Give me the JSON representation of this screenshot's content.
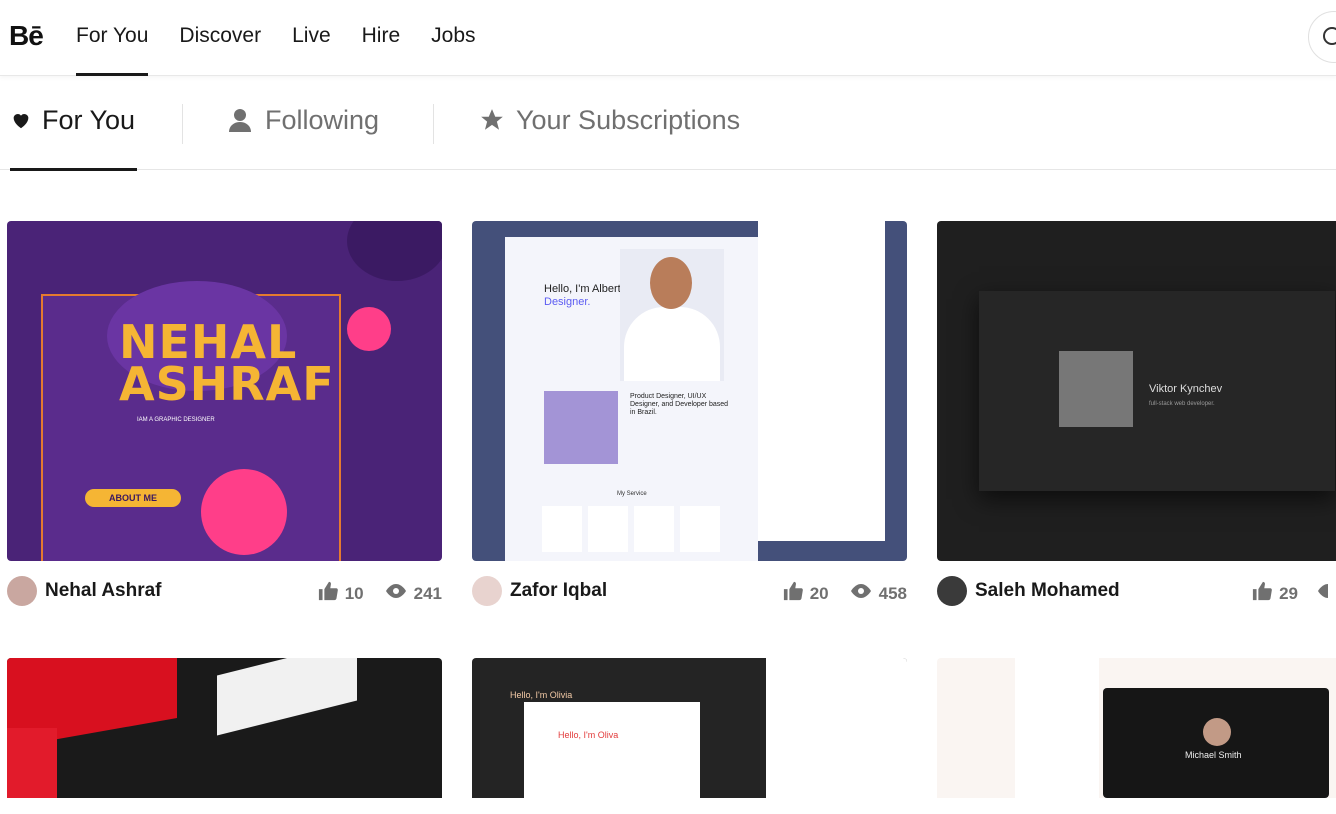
{
  "header": {
    "logo": "Bē",
    "nav": [
      "For You",
      "Discover",
      "Live",
      "Hire",
      "Jobs"
    ]
  },
  "feed_tabs": [
    {
      "label": "For You",
      "icon": "heart-icon"
    },
    {
      "label": "Following",
      "icon": "person-icon"
    },
    {
      "label": "Your Subscriptions",
      "icon": "star-icon"
    }
  ],
  "projects": [
    {
      "owner": "Nehal Ashraf",
      "likes": "10",
      "views": "241",
      "thumb": {
        "line1": "NEHAL",
        "line2": "ASHRAF",
        "tagline": "IAM A GRAPHIC DESIGNER",
        "button": "ABOUT ME"
      }
    },
    {
      "owner": "Zafor Iqbal",
      "likes": "20",
      "views": "458",
      "thumb": {
        "hello": "Hello, I'm Albert, a UI/UX",
        "accent": "Designer.",
        "product": "Product Designer, UI/UX Designer, and Developer based in Brazil.",
        "service": "My Service"
      }
    },
    {
      "owner": "Saleh Mohamed",
      "likes": "29",
      "views": "",
      "thumb": {
        "name": "Viktor Kynchev",
        "role": "full-stack web developer."
      }
    },
    {
      "owner": "",
      "likes": "",
      "views": "",
      "thumb": {}
    },
    {
      "owner": "",
      "likes": "",
      "views": "",
      "thumb": {
        "hello": "Hello, I'm Olivia",
        "hero": "Hello, I'm Oliva"
      }
    },
    {
      "owner": "",
      "likes": "",
      "views": "",
      "thumb": {
        "name": "Michael Smith"
      }
    }
  ],
  "colors": {
    "accent": "#191919",
    "muted": "#707070",
    "card1": "#4a2377",
    "card2": "#44507a",
    "card3": "#1f1f1f"
  }
}
